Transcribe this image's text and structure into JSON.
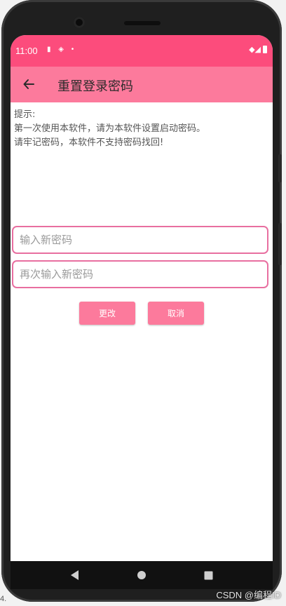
{
  "status_bar": {
    "time": "11:00",
    "left_icons": "▮ ◈ •",
    "right_icons": "◆◢"
  },
  "app_bar": {
    "title": "重置登录密码"
  },
  "hint": {
    "line1": "提示:",
    "line2": "第一次使用本软件，请为本软件设置启动密码。",
    "line3": "请牢记密码，本软件不支持密码找回!"
  },
  "form": {
    "new_password_placeholder": "输入新密码",
    "confirm_password_placeholder": "再次输入新密码",
    "change_label": "更改",
    "cancel_label": "取消"
  },
  "watermark": "CSDN @编程ID",
  "corner_mark": "4.",
  "colors": {
    "status_bar": "#fc4c7c",
    "app_bar": "#fc7a9c",
    "input_border": "#e86fa0",
    "button": "#fc7a9c"
  }
}
